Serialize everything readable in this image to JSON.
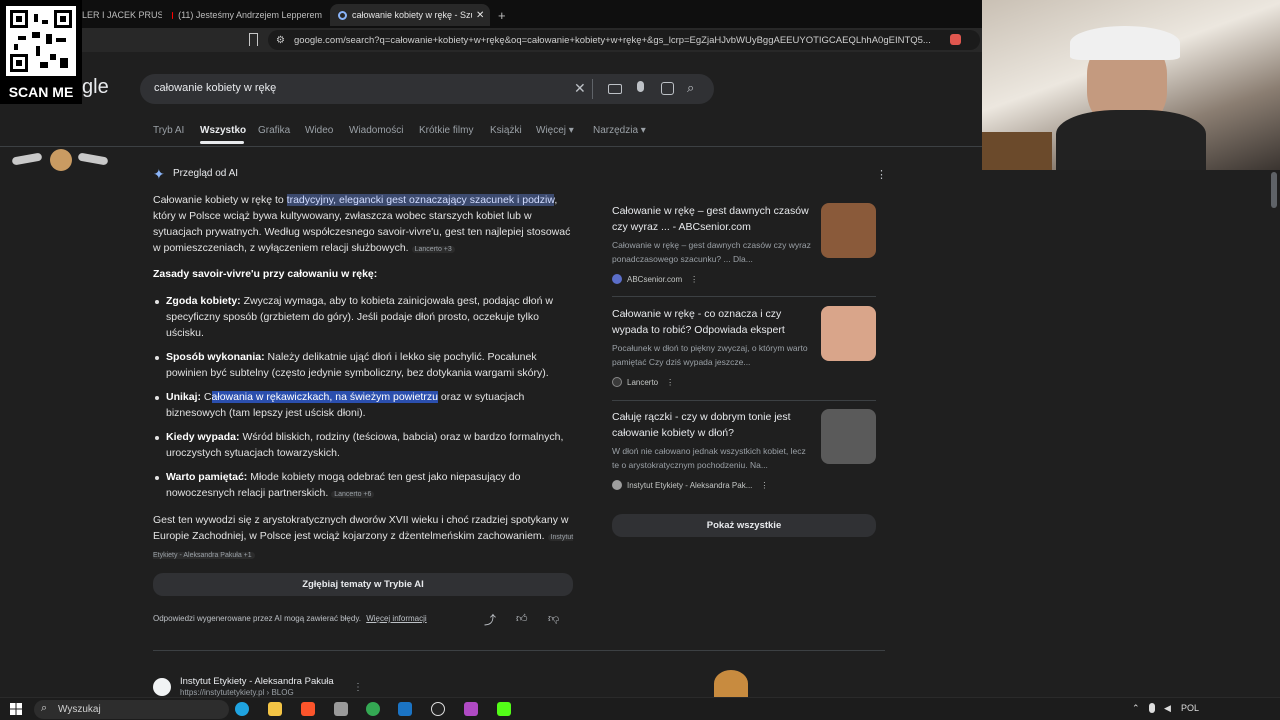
{
  "browser": {
    "tabs": [
      {
        "label": "LER I JACEK PRUSINO"
      },
      {
        "label": "(11) Jesteśmy Andrzejem Lepperem"
      },
      {
        "label": "całowanie kobiety w rękę - Szuka",
        "active": true
      }
    ],
    "url": "google.com/search?q=całowanie+kobiety+w+rękę&oq=całowanie+kobiety+w+rękę+&gs_lcrp=EgZjaHJvbWUyBggAEEUYOTIGCAEQLhhA0gEINTQ5..."
  },
  "overlay": {
    "qr_label": "SCAN ME",
    "logo_fragment": "gle"
  },
  "search": {
    "query": "całowanie kobiety w rękę"
  },
  "nav_tabs": [
    {
      "label": "Tryb AI"
    },
    {
      "label": "Wszystko",
      "active": true
    },
    {
      "label": "Grafika"
    },
    {
      "label": "Wideo"
    },
    {
      "label": "Wiadomości"
    },
    {
      "label": "Krótkie filmy"
    },
    {
      "label": "Książki"
    },
    {
      "label": "Więcej"
    },
    {
      "label": "Narzędzia"
    }
  ],
  "ai_overview": {
    "title": "Przegląd od AI",
    "intro": {
      "pre": "Całowanie kobiety w rękę to ",
      "highlight": "tradycyjny, elegancki gest oznaczający szacunek i podziw",
      "post": ", który w Polsce wciąż bywa kultywowany, zwłaszcza wobec starszych kobiet lub w sytuacjach prywatnych. Według współczesnego savoir-vivre'u, gest ten najlepiej stosować w pomieszczeniach, z wyłączeniem relacji służbowych.",
      "chip": "Lancerto +3"
    },
    "heading": "Zasady savoir-vivre'u przy całowaniu w rękę:",
    "bullets": [
      {
        "term": "Zgoda kobiety:",
        "text": " Zwyczaj wymaga, aby to kobieta zainicjowała gest, podając dłoń w specyficzny sposób (grzbietem do góry). Jeśli podaje dłoń prosto, oczekuje tylko uścisku."
      },
      {
        "term": "Sposób wykonania:",
        "text": " Należy delikatnie ująć dłoń i lekko się pochylić. Pocałunek powinien być subtelny (często jedynie symboliczny, bez dotykania wargami skóry)."
      },
      {
        "term": "Unikaj:",
        "pre": " C",
        "selected": "ałowania w rękawiczkach, na świeżym powietrzu",
        "text": " oraz w sytuacjach biznesowych (tam lepszy jest uścisk dłoni)."
      },
      {
        "term": "Kiedy wypada:",
        "text": " Wśród bliskich, rodziny (teściowa, babcia) oraz w bardzo formalnych, uroczystych sytuacjach towarzyskich."
      },
      {
        "term": "Warto pamiętać:",
        "text": " Młode kobiety mogą odebrać ten gest jako niepasujący do nowoczesnych relacji partnerskich.",
        "chip": "Lancerto +6"
      }
    ],
    "outro": "Gest ten wywodzi się z arystokratycznych dworów XVII wieku i choć rzadziej spotykany w Europie Zachodniej, w Polsce jest wciąż kojarzony z dżentelmeńskim zachowaniem.",
    "outro_chip": "Instytut Etykiety - Aleksandra Pakuła +1",
    "deep_dive": "Zgłębiaj tematy w Trybie AI",
    "disclaimer": "Odpowiedzi wygenerowane przez AI mogą zawierać błędy.",
    "more_info": "Więcej informacji"
  },
  "sources": [
    {
      "title": "Całowanie w rękę – gest dawnych czasów czy wyraz ... - ABCsenior.com",
      "snippet": "Całowanie w rękę – gest dawnych czasów czy wyraz ponadczasowego szacunku? ... Dla...",
      "source": "ABCsenior.com",
      "fav_color": "#5b6ec9",
      "thumb": "#8a5a3a"
    },
    {
      "title": "Całowanie w rękę - co oznacza i czy wypada to robić? Odpowiada ekspert",
      "snippet": "Pocałunek w dłoń to piękny zwyczaj, o którym warto pamiętać Czy dziś wypada jeszcze...",
      "source": "Lancerto",
      "fav_color": "#3a3a3a",
      "thumb": "#d9a58a"
    },
    {
      "title": "Całuję rączki - czy w dobrym tonie jest całowanie kobiety w dłoń?",
      "snippet": "W dłoń nie całowano jednak wszystkich kobiet, lecz te o arystokratycznym pochodzeniu. Na...",
      "source": "Instytut Etykiety - Aleksandra Pak...",
      "fav_color": "#9e9e9e",
      "thumb": "#5a5a5a"
    }
  ],
  "show_all": "Pokaż wszystkie",
  "result": {
    "title": "Instytut Etykiety - Aleksandra Pakuła",
    "url": "https://instytutetykiety.pl › BLOG"
  },
  "taskbar": {
    "search_label": "Wyszukaj",
    "lang": "POL"
  }
}
